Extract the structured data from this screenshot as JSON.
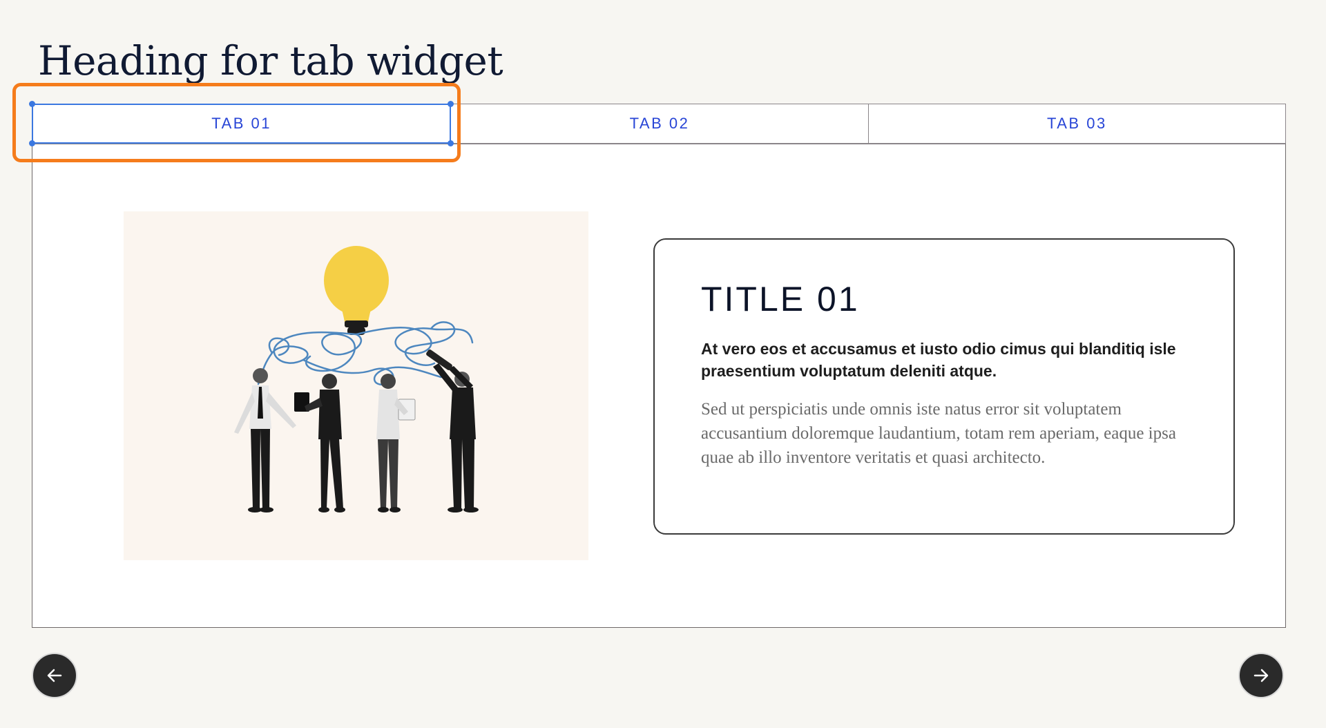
{
  "heading": "Heading for tab widget",
  "tabs": [
    {
      "label": "TAB 01",
      "active": true
    },
    {
      "label": "TAB 02",
      "active": false
    },
    {
      "label": "TAB 03",
      "active": false
    }
  ],
  "panel": {
    "image_icon": "lightbulb-team-illustration-icon",
    "card": {
      "title": "TITLE 01",
      "lead": "At vero eos et accusamus et iusto odio cimus qui blanditiq isle praesentium voluptatum deleniti atque.",
      "body": "Sed ut perspiciatis unde omnis iste natus error sit voluptatem accusantium doloremque laudantium, totam rem aperiam, eaque ipsa quae ab illo inventore veritatis et quasi architecto."
    }
  },
  "navigation": {
    "prev_icon": "arrow-left-icon",
    "next_icon": "arrow-right-icon"
  },
  "colors": {
    "background": "#f7f6f2",
    "tab_text": "#2845d6",
    "selection_outline": "#f57c1c",
    "selection_handles": "#3b78e0",
    "heading": "#101a33",
    "bulb": "#f5cf45",
    "string": "#4d87bf",
    "nav_button": "#2a2a2a"
  }
}
